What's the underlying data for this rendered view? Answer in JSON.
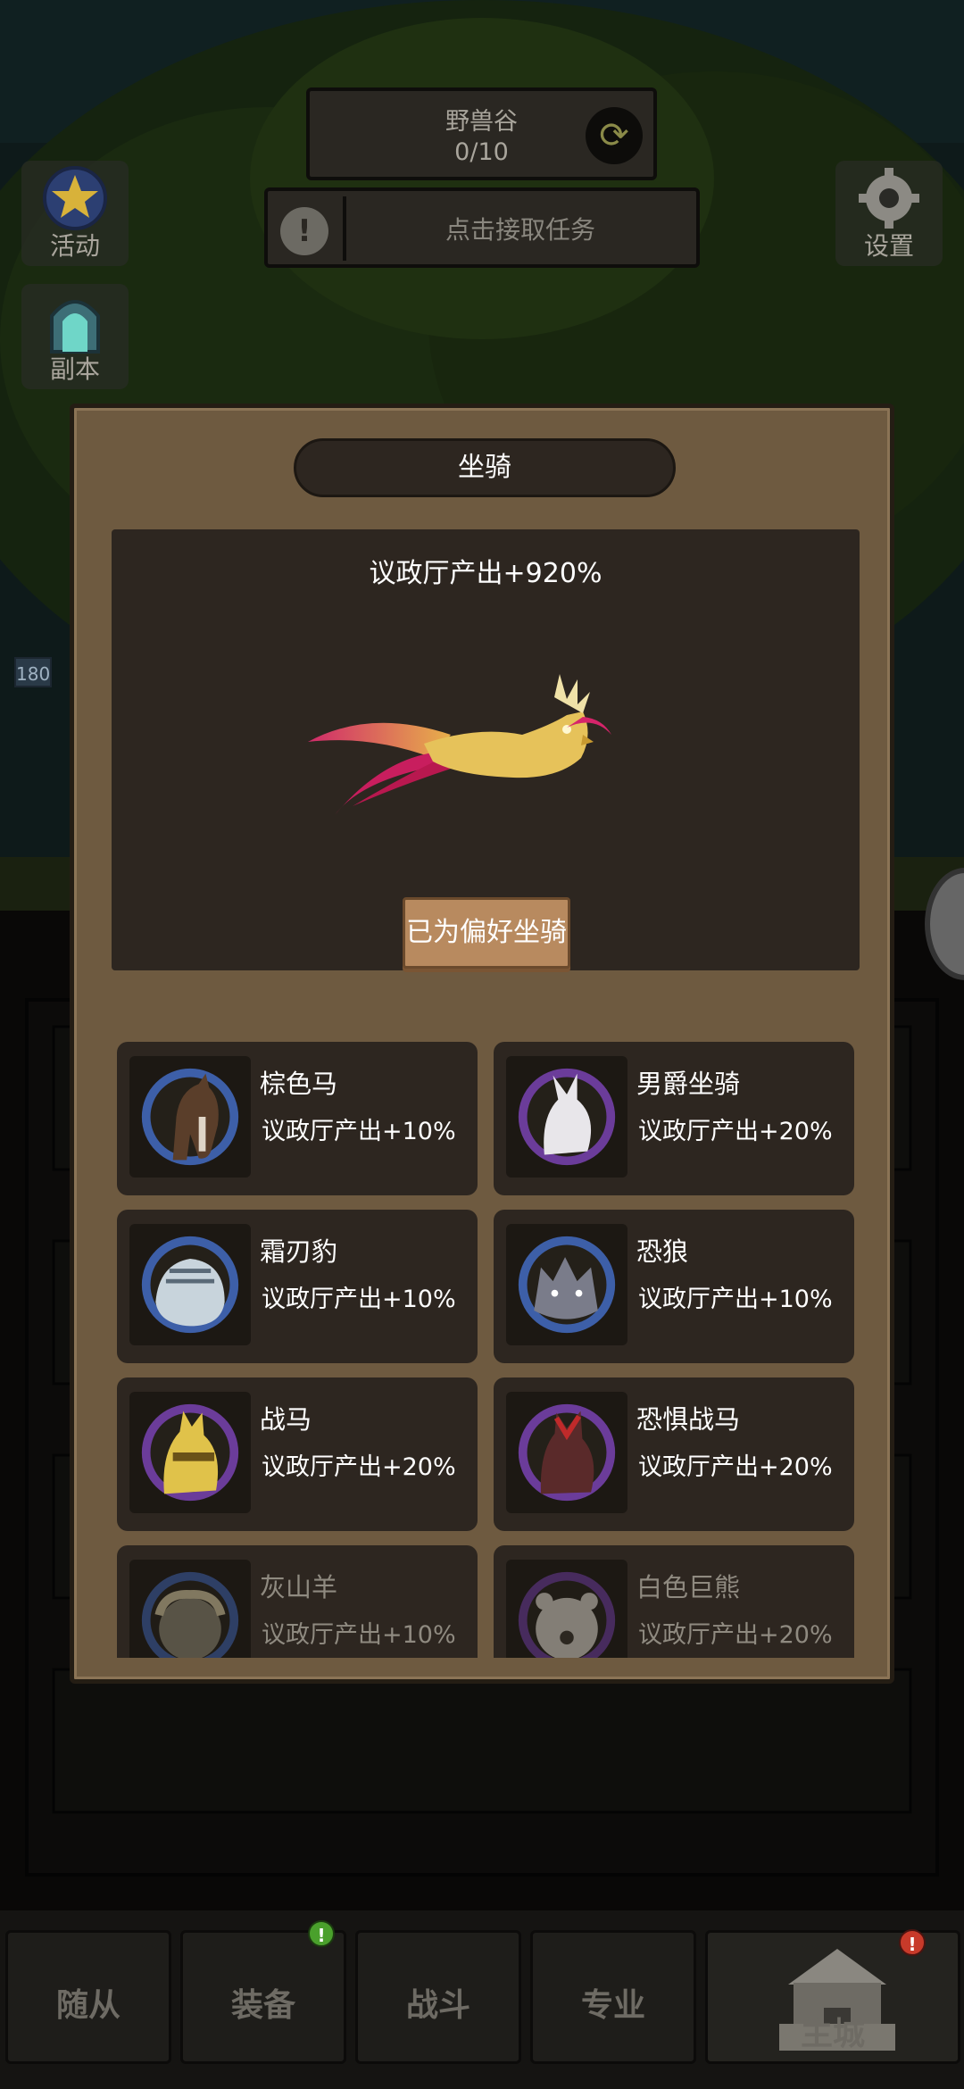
{
  "hud": {
    "map_name": "野兽谷",
    "map_progress": "0/10",
    "quest_text": "点击接取任务",
    "activity_label": "活动",
    "dungeon_label": "副本",
    "settings_label": "设置",
    "level_tag": "180"
  },
  "modal": {
    "title": "坐骑",
    "selected_bonus": "议政厅产出+920%",
    "preference_button": "已为偏好坐骑",
    "mounts": [
      {
        "name": "棕色马",
        "bonus": "议政厅产出+10%",
        "icon": "brown-horse-icon",
        "ring": "#3d5fa8"
      },
      {
        "name": "男爵坐骑",
        "bonus": "议政厅产出+20%",
        "icon": "baron-mount-icon",
        "ring": "#6b3c9a"
      },
      {
        "name": "霜刃豹",
        "bonus": "议政厅产出+10%",
        "icon": "frostsaber-icon",
        "ring": "#3d5fa8"
      },
      {
        "name": "恐狼",
        "bonus": "议政厅产出+10%",
        "icon": "dire-wolf-icon",
        "ring": "#3d5fa8"
      },
      {
        "name": "战马",
        "bonus": "议政厅产出+20%",
        "icon": "warhorse-icon",
        "ring": "#6b3c9a"
      },
      {
        "name": "恐惧战马",
        "bonus": "议政厅产出+20%",
        "icon": "dreadsteed-icon",
        "ring": "#6b3c9a"
      },
      {
        "name": "灰山羊",
        "bonus": "议政厅产出+10%",
        "icon": "grey-ram-icon",
        "ring": "#3d5fa8"
      },
      {
        "name": "白色巨熊",
        "bonus": "议政厅产出+20%",
        "icon": "white-bear-icon",
        "ring": "#6b3c9a"
      }
    ]
  },
  "bottom_nav": {
    "tabs": [
      "随从",
      "装备",
      "战斗",
      "专业",
      "主城"
    ],
    "equipment_badge": "!",
    "castle_badge": "!"
  },
  "colors": {
    "panel": "#6e5a40",
    "panel_dark": "#2d2620",
    "button": "#b88a5f",
    "rare_ring": "#3d5fa8",
    "epic_ring": "#6b3c9a"
  }
}
